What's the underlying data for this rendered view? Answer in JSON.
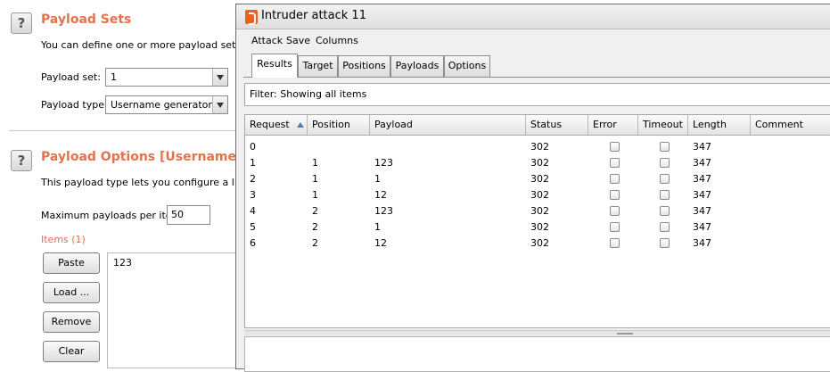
{
  "background": {
    "payload_sets": {
      "title": "Payload Sets",
      "description": "You can define one or more payload sets. Th",
      "set_label": "Payload set:",
      "set_value": "1",
      "type_label": "Payload type:",
      "type_value": "Username generator"
    },
    "payload_options": {
      "title": "Payload Options [Username gener",
      "description": "This payload type lets you configure a list of",
      "max_label": "Maximum payloads per item:",
      "max_value": "50",
      "items_label": "Items (1)",
      "buttons": [
        "Paste",
        "Load ...",
        "Remove",
        "Clear"
      ],
      "items": [
        "123"
      ]
    },
    "help_glyph": "?"
  },
  "window": {
    "title": "Intruder attack 11",
    "menu": [
      "Attack",
      "Save",
      "Columns"
    ],
    "tabs": [
      "Results",
      "Target",
      "Positions",
      "Payloads",
      "Options"
    ],
    "active_tab": 0,
    "filter": "Filter:  Showing all items",
    "columns": [
      "Request",
      "Position",
      "Payload",
      "Status",
      "Error",
      "Timeout",
      "Length",
      "Comment"
    ],
    "rows": [
      {
        "request": "0",
        "position": "",
        "payload": "",
        "status": "302",
        "length": "347"
      },
      {
        "request": "1",
        "position": "1",
        "payload": "123",
        "status": "302",
        "length": "347"
      },
      {
        "request": "2",
        "position": "1",
        "payload": "1",
        "status": "302",
        "length": "347"
      },
      {
        "request": "3",
        "position": "1",
        "payload": "12",
        "status": "302",
        "length": "347"
      },
      {
        "request": "4",
        "position": "2",
        "payload": "123",
        "status": "302",
        "length": "347"
      },
      {
        "request": "5",
        "position": "2",
        "payload": "1",
        "status": "302",
        "length": "347"
      },
      {
        "request": "6",
        "position": "2",
        "payload": "12",
        "status": "302",
        "length": "347"
      }
    ]
  },
  "colors": {
    "accent": "#e4724b",
    "burp_orange": "#e8621f",
    "sort_arrow": "#4f7fb3"
  }
}
